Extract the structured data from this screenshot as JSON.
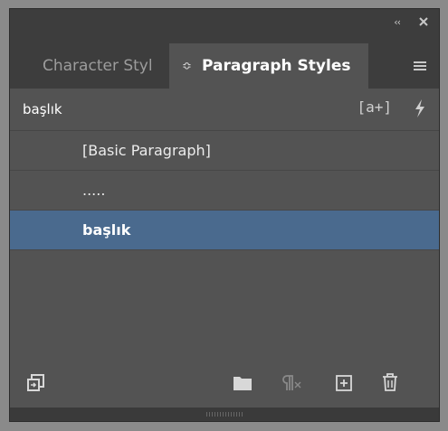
{
  "panel": {
    "collapse_glyph": "‹‹",
    "tabs": [
      {
        "label": "Character Styl"
      },
      {
        "label": "Paragraph Styles",
        "arrows": "≎"
      }
    ]
  },
  "header": {
    "current_style": "başlık",
    "clear_override_glyph": "[a+]"
  },
  "styles": [
    {
      "label": "[Basic Paragraph]"
    },
    {
      "label": "....."
    },
    {
      "label": "başlık",
      "selected": true
    }
  ],
  "colors": {
    "panel_bg": "#535353",
    "tab_bg": "#3d3d3d",
    "selection": "#4a6a8e"
  }
}
